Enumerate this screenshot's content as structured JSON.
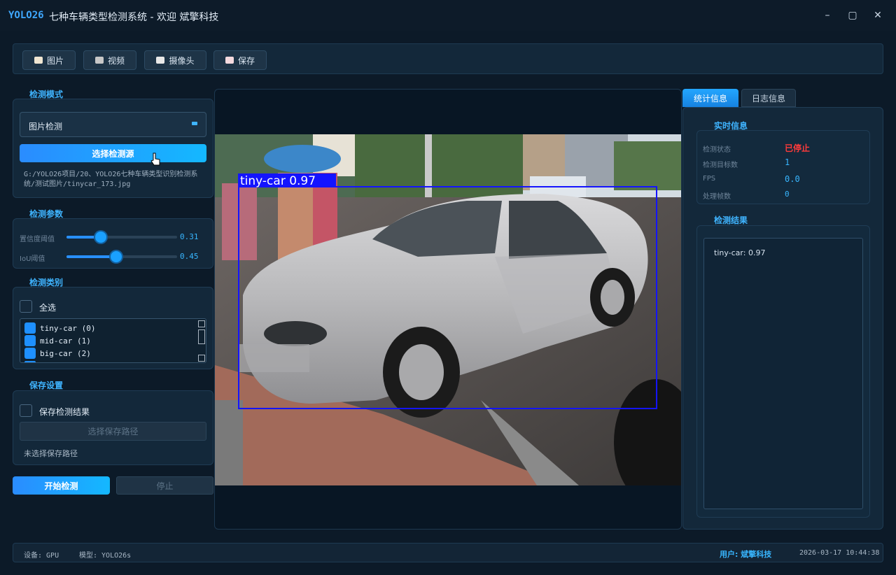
{
  "window": {
    "brand": "YOLO26",
    "title": "七种车辆类型检测系统 - 欢迎 斌擎科技",
    "min_glyph": "–",
    "max_glyph": "▢",
    "close_glyph": "✕"
  },
  "toolbar": {
    "image_label": "图片",
    "video_label": "视频",
    "camera_label": "摄像头",
    "save_label": "保存"
  },
  "left": {
    "mode_title": "检测模式",
    "mode_value": "图片检测",
    "select_source_label": "选择检测源",
    "source_path": "G:/YOLO26项目/20、YOLO26七种车辆类型识别检测系统/测试图片/tinycar_173.jpg",
    "params_title": "检测参数",
    "conf_label": "置信度阈值",
    "conf_value": "0.31",
    "conf_level": 0.31,
    "iou_label": "IoU阈值",
    "iou_value": "0.45",
    "iou_level": 0.45,
    "classes_title": "检测类别",
    "select_all_label": "全选",
    "classes": [
      {
        "label": "tiny-car (0)"
      },
      {
        "label": "mid-car (1)"
      },
      {
        "label": "big-car (2)"
      }
    ],
    "save_title": "保存设置",
    "save_results_label": "保存检测结果",
    "choose_path_label": "选择保存路径",
    "no_path_text": "未选择保存路径",
    "start_label": "开始检测",
    "stop_label": "停止"
  },
  "display": {
    "detection_label": "tiny-car 0.97",
    "box_color": "#1414ff"
  },
  "right": {
    "tab_stats": "统计信息",
    "tab_log": "日志信息",
    "realtime_title": "实时信息",
    "status_label": "检测状态",
    "status_value": "已停止",
    "targets_label": "检测目标数",
    "targets_value": "1",
    "fps_label": "FPS",
    "fps_value": "0.0",
    "frames_label": "处理帧数",
    "frames_value": "0",
    "results_title": "检测结果",
    "results": [
      "tiny-car: 0.97"
    ]
  },
  "status": {
    "device": "设备: GPU",
    "model": "模型: YOLO26s",
    "user": "用户: 斌擎科技",
    "datetime": "2026-03-17 10:44:38"
  },
  "colors": {
    "accent": "#1e90ff",
    "status_stopped": "#ff3b3b",
    "bg": "#0c1a28"
  }
}
